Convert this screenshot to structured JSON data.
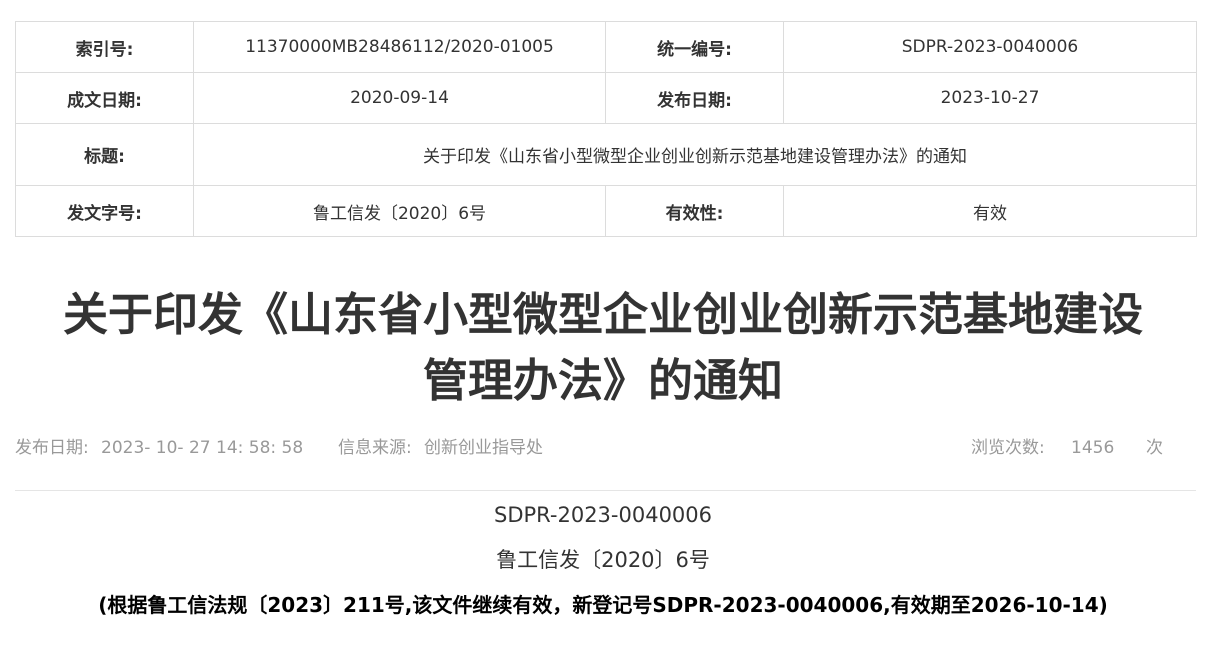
{
  "meta_table": {
    "index_no_label": "索引号:",
    "index_no": "11370000MB28486112/2020-01005",
    "unified_no_label": "统一编号:",
    "unified_no": "SDPR-2023-0040006",
    "written_date_label": "成文日期:",
    "written_date": "2020-09-14",
    "publish_date_label": "发布日期:",
    "publish_date": "2023-10-27",
    "title_label": "标题:",
    "title": "关于印发《山东省小型微型企业创业创新示范基地建设管理办法》的通知",
    "doc_no_label": "发文字号:",
    "doc_no": "鲁工信发〔2020〕6号",
    "validity_label": "有效性:",
    "validity": "有效"
  },
  "article": {
    "title_line1": "关于印发《山东省小型微型企业创业创新示范基地建设",
    "title_line2": "管理办法》的通知"
  },
  "info_bar": {
    "publish_label": "发布日期:",
    "publish_value": "2023- 10- 27 14: 58: 58",
    "source_label": "信息来源:",
    "source_value": "创新创业指导处",
    "views_label": "浏览次数:",
    "views_count": "1456",
    "views_unit": "次"
  },
  "body": {
    "line1": "SDPR-2023-0040006",
    "line2": "鲁工信发〔2020〕6号",
    "note": "(根据鲁工信法规〔2023〕211号,该文件继续有效，新登记号SDPR-2023-0040006,有效期至2026-10-14)"
  }
}
